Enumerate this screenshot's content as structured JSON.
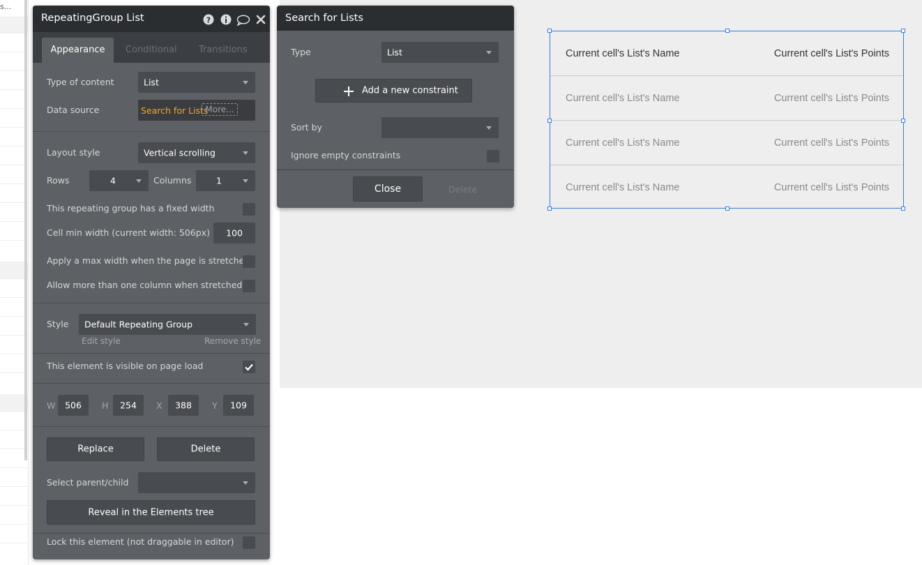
{
  "left_strip": {
    "top_text": "s..."
  },
  "property_panel": {
    "title": "RepeatingGroup List",
    "tabs": [
      "Appearance",
      "Conditional",
      "Transitions"
    ],
    "type_of_content_label": "Type of content",
    "type_of_content_value": "List",
    "data_source_label": "Data source",
    "data_source_value": "Search for Lists",
    "data_source_more": "More...",
    "layout_style_label": "Layout style",
    "layout_style_value": "Vertical scrolling",
    "rows_label": "Rows",
    "rows_value": "4",
    "columns_label": "Columns",
    "columns_value": "1",
    "fixed_width_label": "This repeating group has a fixed width",
    "cell_min_width_label": "Cell min width (current width: 506px)",
    "cell_min_width_value": "100",
    "max_width_label": "Apply a max width when the page is stretched",
    "more_columns_label": "Allow more than one column when stretched",
    "style_label": "Style",
    "style_value": "Default Repeating Group",
    "edit_style": "Edit style",
    "remove_style": "Remove style",
    "visible_label": "This element is visible on page load",
    "visible_checked": true,
    "w_label": "W",
    "w_value": "506",
    "h_label": "H",
    "h_value": "254",
    "x_label": "X",
    "x_value": "388",
    "y_label": "Y",
    "y_value": "109",
    "replace_button": "Replace",
    "delete_button": "Delete",
    "select_parent_label": "Select parent/child",
    "reveal_button": "Reveal in the Elements tree",
    "lock_label": "Lock this element (not draggable in editor)"
  },
  "search_panel": {
    "title": "Search for Lists",
    "type_label": "Type",
    "type_value": "List",
    "add_constraint": "Add a new constraint",
    "sort_by_label": "Sort by",
    "ignore_empty_label": "Ignore empty constraints",
    "close_button": "Close",
    "delete_button": "Delete"
  },
  "repeating_group": {
    "rows": [
      {
        "name": "Current cell's List's Name",
        "points": "Current cell's List's Points"
      },
      {
        "name": "Current cell's List's Name",
        "points": "Current cell's List's Points"
      },
      {
        "name": "Current cell's List's Name",
        "points": "Current cell's List's Points"
      },
      {
        "name": "Current cell's List's Name",
        "points": "Current cell's List's Points"
      }
    ]
  },
  "colors": {
    "panel_bg": "#5d6064",
    "panel_header": "#2b2e31",
    "field_bg": "#484b4f",
    "accent_orange": "#f5a623",
    "selection_blue": "#3b7bd4",
    "canvas_bg": "#eeeeee"
  }
}
